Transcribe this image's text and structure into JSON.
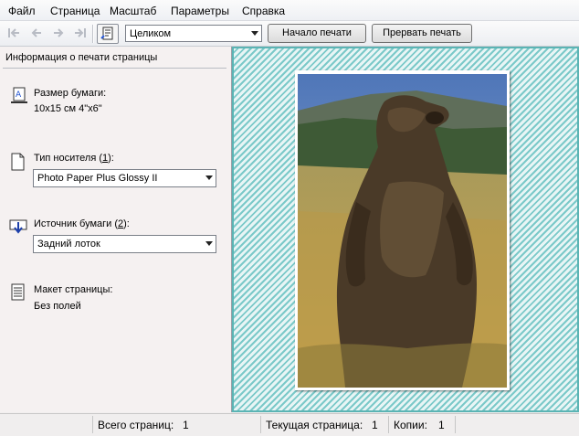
{
  "menu": [
    "Файл",
    "Страница",
    "Масштаб",
    "Параметры",
    "Справка"
  ],
  "toolbar": {
    "zoom_value": "Целиком",
    "start_print": "Начало печати",
    "abort_print": "Прервать печать"
  },
  "panel": {
    "header": "Информация о печати страницы",
    "paper_size_label": "Размер бумаги:",
    "paper_size_value": "10x15 см 4\"x6\"",
    "media_type_label_pre": "Тип носителя (",
    "media_type_label_key": "1",
    "media_type_label_post": "):",
    "media_type_value": "Photo Paper Plus Glossy II",
    "source_label_pre": "Источник бумаги (",
    "source_label_key": "2",
    "source_label_post": "):",
    "source_value": "Задний лоток",
    "layout_label": "Макет страницы:",
    "layout_value": "Без полей"
  },
  "status": {
    "total_label": "Всего страниц:",
    "total_value": "1",
    "current_label": "Текущая страница:",
    "current_value": "1",
    "copies_label": "Копии:",
    "copies_value": "1"
  }
}
